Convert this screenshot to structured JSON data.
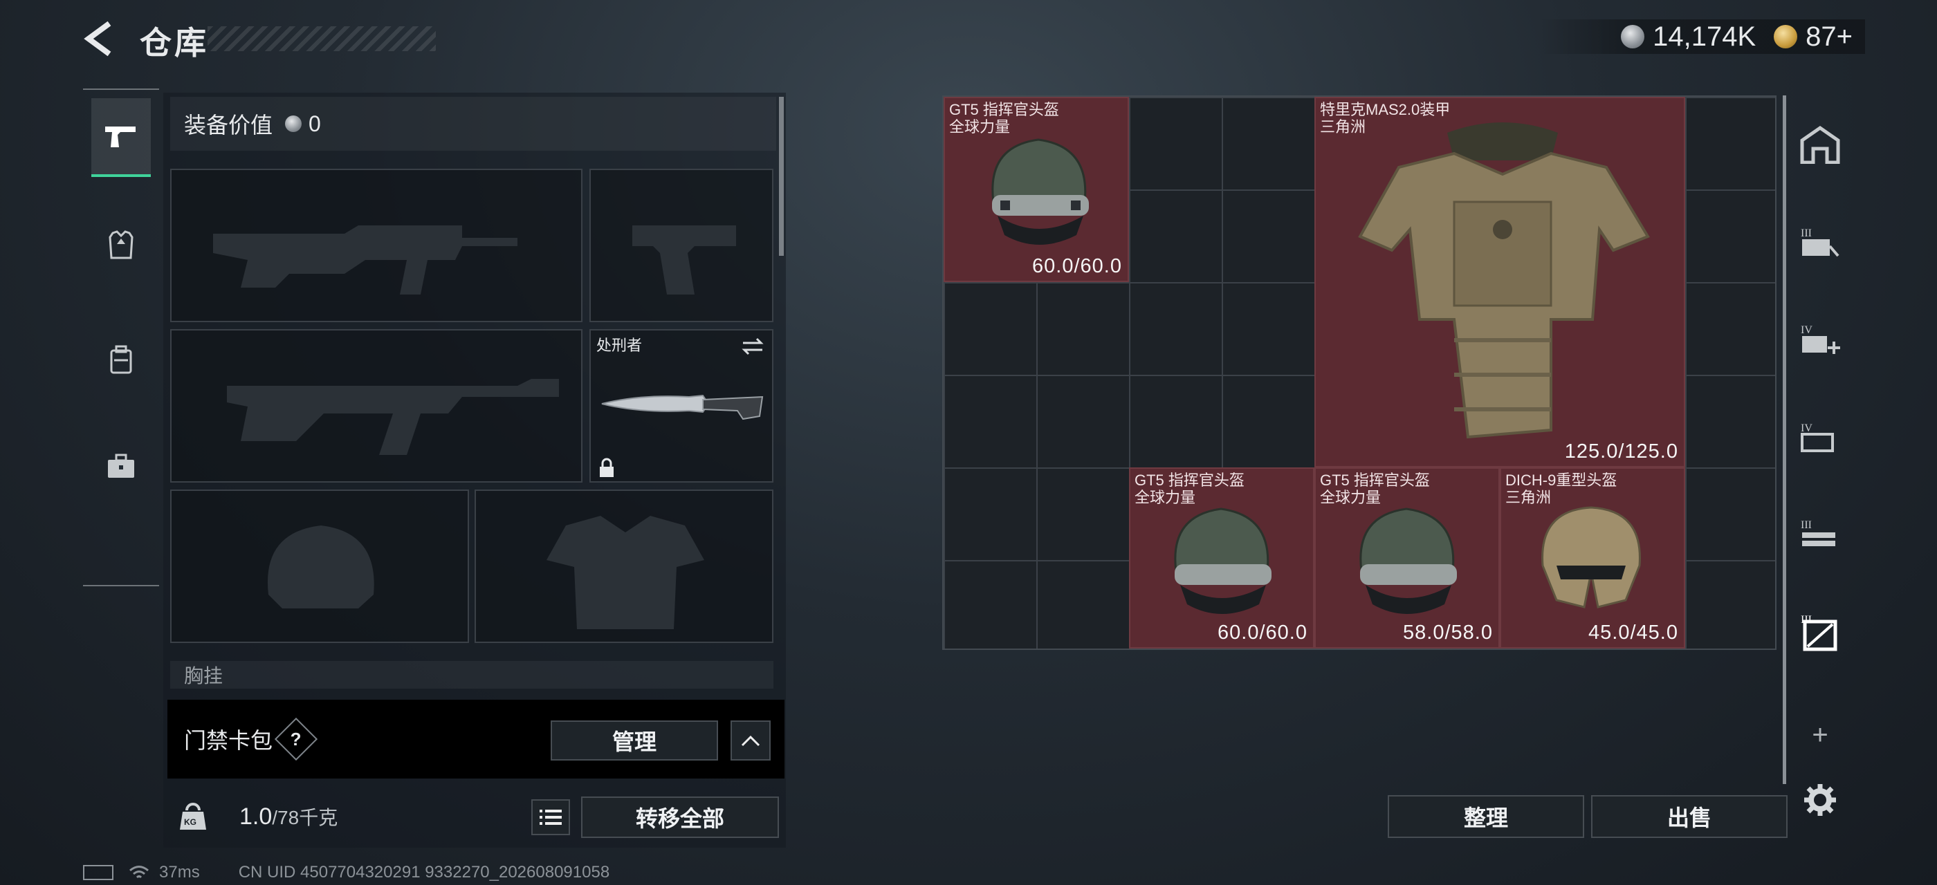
{
  "header": {
    "title": "仓库",
    "currency_amount": "14,174K",
    "premium_amount": "87+"
  },
  "left_panel": {
    "equipment_value_label": "装备价值",
    "equipment_value": "0",
    "knife_name": "处刑者",
    "chest_rig_label": "胸挂",
    "keycase_label": "门禁卡包",
    "keycase_help": "?",
    "manage_button": "管理",
    "weight_current": "1.0",
    "weight_max": "/78千克",
    "weight_icon_text": "KG",
    "transfer_all_button": "转移全部"
  },
  "stash_items": [
    {
      "name": "GT5 指挥官头盔",
      "tag": "全球力量",
      "durability": "60.0/60.0"
    },
    {
      "name": "特里克MAS2.0装甲",
      "tag": "三角洲",
      "durability": "125.0/125.0"
    },
    {
      "name": "GT5 指挥官头盔",
      "tag": "全球力量",
      "durability": "60.0/60.0"
    },
    {
      "name": "GT5 指挥官头盔",
      "tag": "全球力量",
      "durability": "58.0/58.0"
    },
    {
      "name": "DICH-9重型头盔",
      "tag": "三角洲",
      "durability": "45.0/45.0"
    }
  ],
  "actions": {
    "sort_button": "整理",
    "sell_button": "出售"
  },
  "rail": {
    "add_label": "+"
  },
  "status_bar": {
    "ping": "37ms",
    "uid": "CN UID 4507704320291 9332270_202608091058"
  },
  "colors": {
    "item_bg": "#5b2a31",
    "active_tab": "#3fd39a"
  }
}
